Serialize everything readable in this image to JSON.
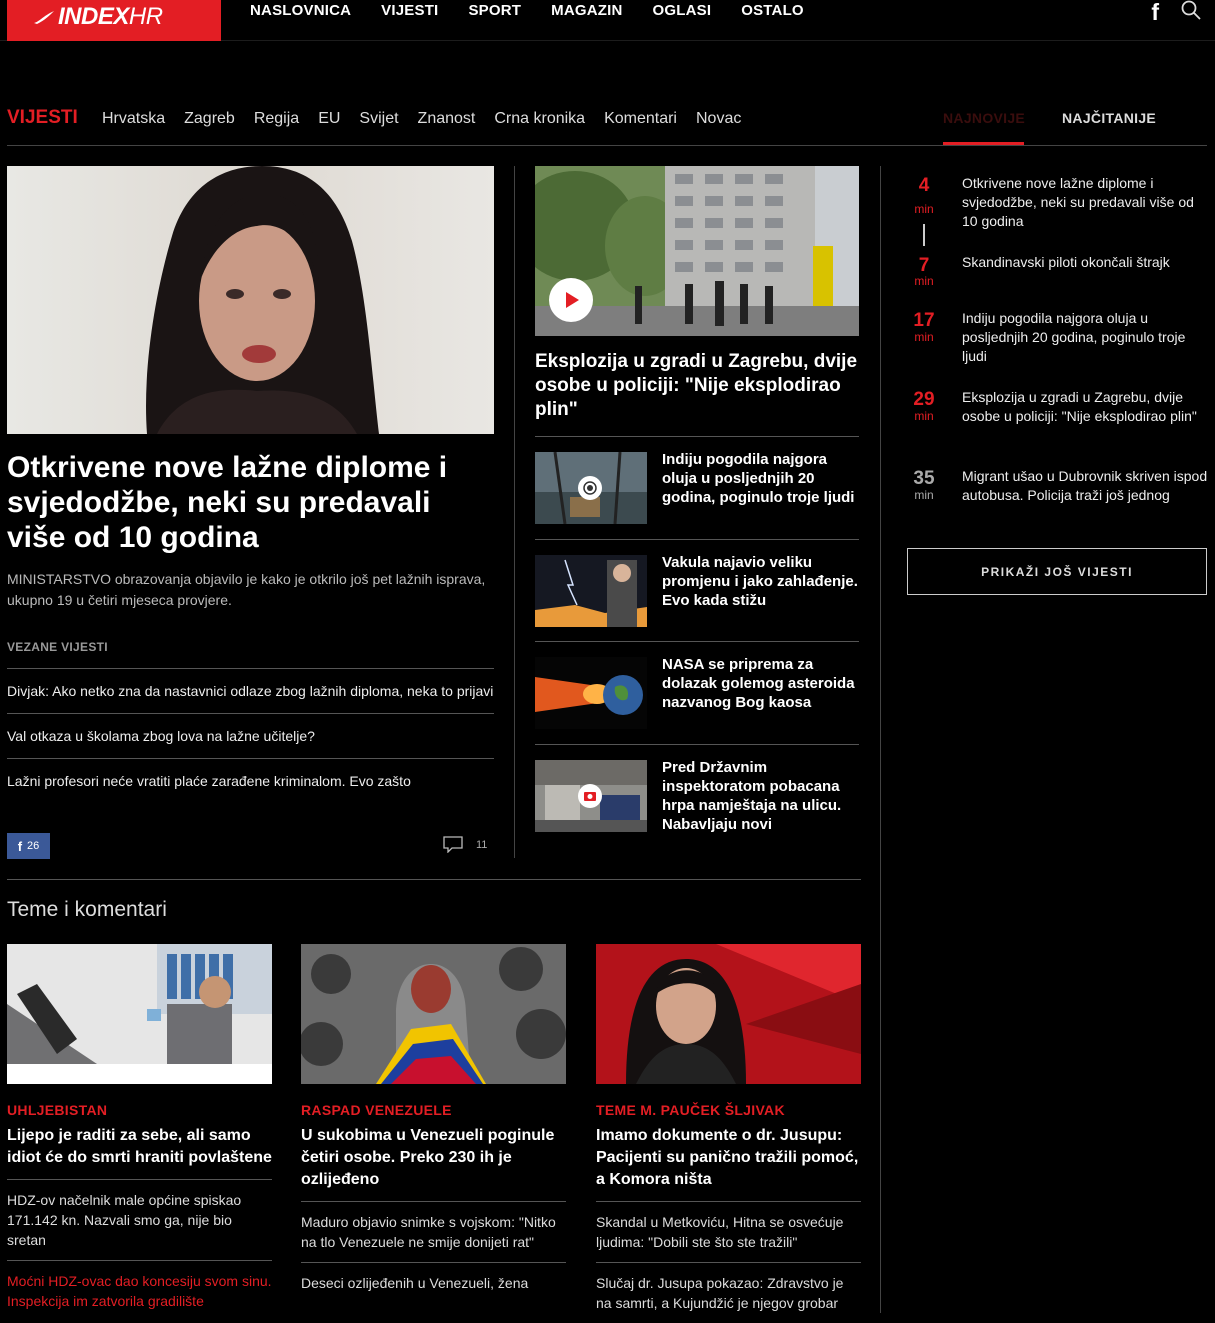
{
  "header": {
    "logo_main": "INDEX",
    "logo_suffix": "HR",
    "nav": [
      "NASLOVNICA",
      "VIJESTI",
      "SPORT",
      "MAGAZIN",
      "OGLASI",
      "OSTALO"
    ],
    "facebook_glyph": "f"
  },
  "subnav": {
    "section": "VIJESTI",
    "categories": [
      "Hrvatska",
      "Zagreb",
      "Regija",
      "EU",
      "Svijet",
      "Znanost",
      "Crna kronika",
      "Komentari",
      "Novac"
    ],
    "tab_latest": "NAJNOVIJE",
    "tab_most_read": "NAJČITANIJE"
  },
  "lead": {
    "title": "Otkrivene nove lažne diplome i svjedodžbe, neki su predavali više od 10 godina",
    "subtitle": "MINISTARSTVO obrazovanja objavilo je kako je otkrilo još pet lažnih isprava, ukupno 19 u četiri mjeseca provjere.",
    "related_heading": "VEZANE VIJESTI",
    "related": [
      "Divjak: Ako netko zna da nastavnici odlaze zbog lažnih diploma, neka to prijavi",
      "Val otkaza u školama zbog lova na lažne učitelje?",
      "Lažni profesori neće vratiti plaće zarađene kriminalom. Evo zašto"
    ],
    "fb_glyph": "f",
    "fb_count": "26",
    "comment_count": "11"
  },
  "middle": {
    "title": "Eksplozija u zgradi u Zagrebu, dvije osobe u policiji: \"Nije eksplodirao plin\"",
    "items": [
      "Indiju pogodila najgora oluja u posljednjih 20 godina, poginulo troje ljudi",
      "Vakula najavio veliku promjenu i jako zahlađenje. Evo kada stižu",
      "NASA se priprema za dolazak golemog asteroida nazvanog Bog kaosa",
      "Pred Državnim inspektoratom pobacana hrpa namještaja na ulicu. Nabavljaju novi"
    ]
  },
  "latest": {
    "items": [
      {
        "num": "4",
        "unit": "min",
        "text": "Otkrivene nove lažne diplome i svjedodžbe, neki su predavali više od 10 godina"
      },
      {
        "num": "7",
        "unit": "min",
        "text": "Skandinavski piloti okončali štrajk"
      },
      {
        "num": "17",
        "unit": "min",
        "text": "Indiju pogodila najgora oluja u posljednjih 20 godina, poginulo troje ljudi"
      },
      {
        "num": "29",
        "unit": "min",
        "text": "Eksplozija u zgradi u Zagrebu, dvije osobe u policiji: \"Nije eksplodirao plin\""
      },
      {
        "num": "35",
        "unit": "min",
        "text": "Migrant ušao u Dubrovnik skriven ispod autobusa. Policija traži još jednog"
      }
    ],
    "more_button": "PRIKAŽI JOŠ VIJESTI"
  },
  "teme": {
    "heading": "Teme i komentari",
    "columns": [
      {
        "kicker": "UHLJEBISTAN",
        "title": "Lijepo je raditi za sebe, ali samo idiot će do smrti hraniti povlaštene",
        "subs": [
          "HDZ-ov načelnik male općine spiskao 171.142 kn. Nazvali smo ga, nije bio sretan",
          "Moćni HDZ-ovac dao koncesiju svom sinu. Inspekcija im zatvorila gradilište"
        ]
      },
      {
        "kicker": "RASPAD VENEZUELE",
        "title": "U sukobima u Venezueli poginule četiri osobe. Preko 230 ih je ozlijeđeno",
        "subs": [
          "Maduro objavio snimke s vojskom: \"Nitko na tlo Venezuele ne smije donijeti rat\"",
          "Deseci ozlijeđenih u Venezueli, žena"
        ]
      },
      {
        "kicker": "TEME M. PAUČEK ŠLJIVAK",
        "title": "Imamo dokumente o dr. Jusupu: Pacijenti su panično tražili pomoć, a Komora ništa",
        "subs": [
          "Skandal u Metkoviću, Hitna se osvećuje ljudima: \"Dobili ste što ste tražili\"",
          "Slučaj dr. Jusupa pokazao: Zdravstvo je na samrti, a Kujundžić je njegov grobar"
        ]
      }
    ]
  },
  "colors": {
    "accent": "#e31e24",
    "facebook": "#3b5998",
    "background": "#000000"
  }
}
